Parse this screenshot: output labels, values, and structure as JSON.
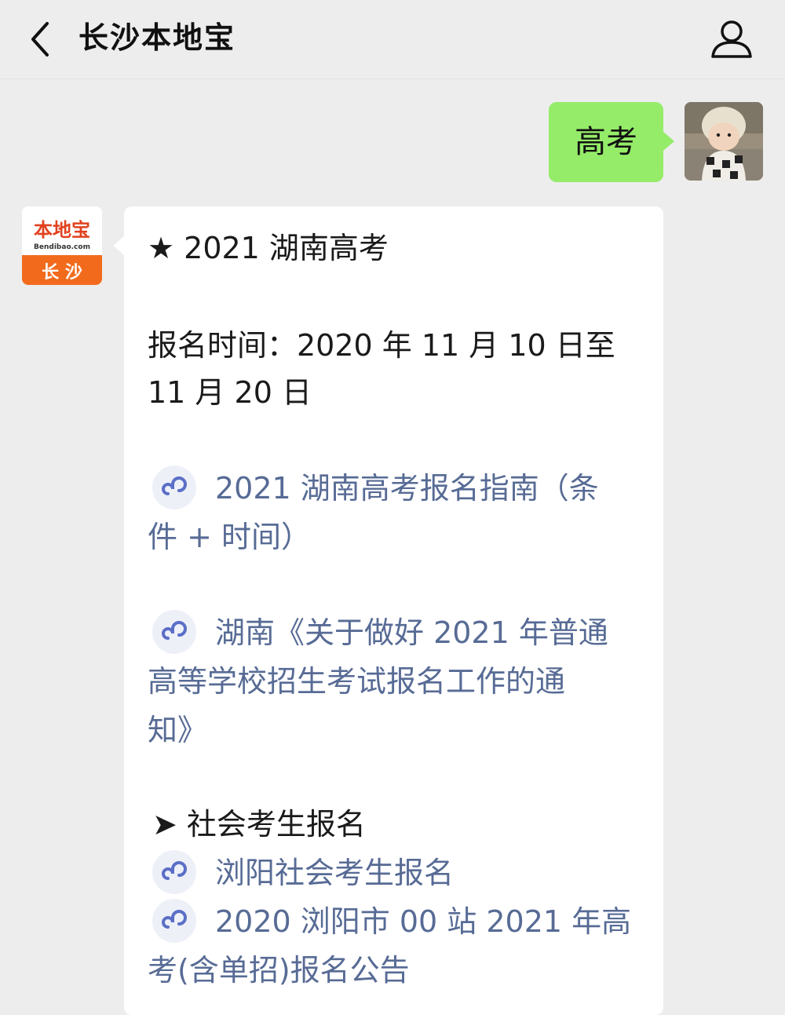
{
  "header": {
    "title": "长沙本地宝",
    "back_icon": "chevron-left-icon",
    "profile_icon": "person-icon"
  },
  "user_message": {
    "text": "高考"
  },
  "bot_avatar": {
    "brand": "本地宝",
    "domain": "Bendibao.com",
    "city": "长沙"
  },
  "bot_message": {
    "heading": "★ 2021 湖南高考",
    "signup_line1": "报名时间：2020 年 11 月 10 日至",
    "signup_line2": "11 月 20 日",
    "link1_line1": "2021 湖南高考报名指南（条",
    "link1_line2": "件 + 时间）",
    "link2_line1": "湖南《关于做好 2021 年普通",
    "link2_line2": "高等学校招生考试报名工作的通",
    "link2_line3": "知》",
    "section_heading": "➤ 社会考生报名",
    "link3": "浏阳社会考生报名",
    "link4_line1": "2020 浏阳市 00 站 2021 年高",
    "link4_line2": "考(含单招)报名公告"
  },
  "colors": {
    "background": "#ededed",
    "user_bubble": "#95ec69",
    "link": "#576b95",
    "brand_orange": "#f26b1d"
  }
}
